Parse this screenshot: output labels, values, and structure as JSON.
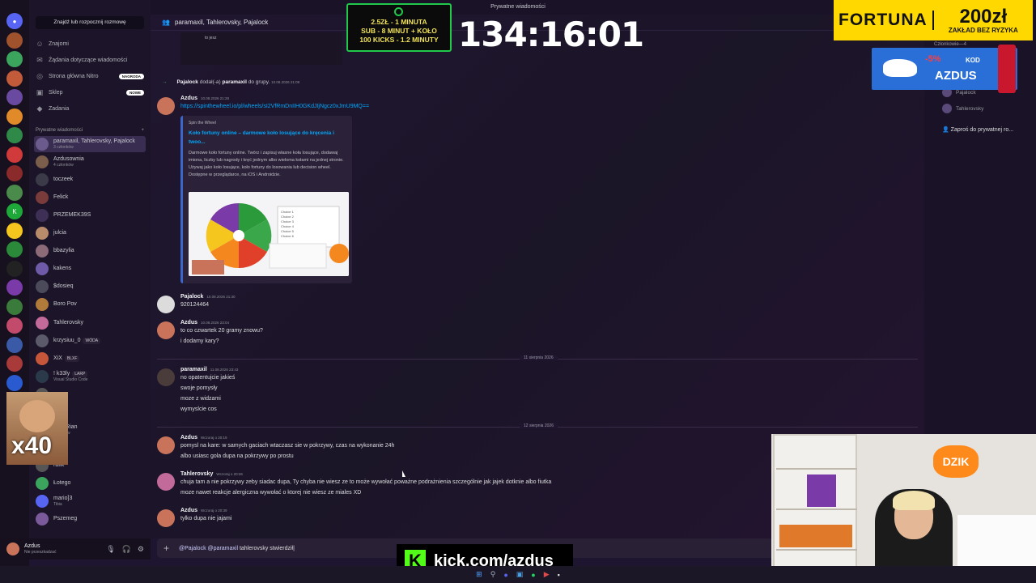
{
  "window": {
    "title": "Prywatne wiadomości"
  },
  "sidebar": {
    "search_button": "Znajdź lub rozpocznij rozmowę",
    "nav": [
      {
        "label": "Znajomi",
        "icon": "friends-icon"
      },
      {
        "label": "Żądania dotyczące wiadomości",
        "icon": "message-requests-icon"
      },
      {
        "label": "Strona główna Nitro",
        "icon": "nitro-icon",
        "badge": "NAGRODA"
      },
      {
        "label": "Sklep",
        "icon": "shop-icon",
        "badge": "NOWE"
      },
      {
        "label": "Zadania",
        "icon": "quests-icon"
      }
    ],
    "dm_header": "Prywatne wiadomości",
    "dm_add": "+",
    "dms": [
      {
        "name": "paramaxil, Tahlerovsky, Pajalock",
        "sub": "3 członków",
        "active": true,
        "color": "#6b5a8c"
      },
      {
        "name": "Azdusownia",
        "sub": "4 członków",
        "color": "#7a5d4a"
      },
      {
        "name": "toczeek",
        "sub": "",
        "color": "#3a3a48"
      },
      {
        "name": "Felick",
        "sub": "",
        "color": "#7a3b3b"
      },
      {
        "name": "PRZEMEK39S",
        "sub": "",
        "color": "#3d2f55"
      },
      {
        "name": "julcia",
        "sub": "",
        "color": "#b88b6a"
      },
      {
        "name": "bbazylia",
        "sub": "",
        "color": "#8c6a78"
      },
      {
        "name": "kakens",
        "sub": "",
        "color": "#6e5aa8"
      },
      {
        "name": "$dosieq",
        "sub": "",
        "color": "#4a4a5a"
      },
      {
        "name": "Boro Pov",
        "sub": "",
        "color": "#b07a3a"
      },
      {
        "name": "Tahlerovsky",
        "sub": "",
        "color": "#c26a9a"
      },
      {
        "name": "krzysiuu_0",
        "sub": "",
        "tag": "WÓDA",
        "color": "#5a5a6a"
      },
      {
        "name": "XiX",
        "sub": "",
        "tag": "BLXF",
        "color": "#c6563a"
      },
      {
        "name": "! k33ly",
        "sub": "Visual Studio Code",
        "tag": "LARP",
        "color": "#2b3a4a"
      },
      {
        "name": "uss",
        "sub": "",
        "color": "#555"
      },
      {
        "name": "cxEQ",
        "sub": "",
        "color": "#444"
      },
      {
        "name": "jpur, Rian",
        "sub": "członków",
        "color": "#555"
      },
      {
        "name": "chito",
        "sub": "",
        "color": "#555"
      },
      {
        "name": "rafik",
        "sub": "",
        "color": "#555"
      },
      {
        "name": "Łotego",
        "sub": "",
        "color": "#3ba55d"
      },
      {
        "name": "mario]3",
        "sub": "Tibia",
        "color": "#5865f2"
      },
      {
        "name": "Pszemeg",
        "sub": "",
        "color": "#7a5a9a"
      }
    ],
    "user": {
      "name": "Azdus",
      "status": "Nie przeszkadzać"
    },
    "webcam_label": "x40"
  },
  "chat": {
    "header": "paramaxil, Tahlerovsky, Pajalock",
    "top_snippet": "to jesz",
    "system": {
      "actor": "Pajalock",
      "action": "dodał(-a)",
      "target": "paramaxil",
      "suffix": "do grupy.",
      "time": "10.08.2026 21:09"
    },
    "messages": [
      {
        "author": "Azdus",
        "time": "10.08.2026 21:28",
        "lines": [
          "https://spinthewheel.io/pl/wheels/sI2VfRmDnIIH0GKdJIjNgcz0xJmU9MQ=="
        ],
        "link": true,
        "color": "#c9745a"
      },
      {
        "author": "Pajalock",
        "time": "10.08.2026 21:30",
        "lines": [
          "920124464"
        ],
        "color": "#dcdcdc"
      },
      {
        "author": "Azdus",
        "time": "10.08.2026 23:04",
        "lines": [
          "to co czwartek 20 gramy znowu?",
          "i dodamy kary?"
        ],
        "color": "#c9745a"
      },
      {
        "author": "paramaxil",
        "time": "11.08.2026 23:43",
        "lines": [
          "no opatentujcie jakieś",
          "swoje pomysły",
          "moze z widzami",
          "wymyslcie cos"
        ],
        "color": "#4a3c3a"
      },
      {
        "author": "Azdus",
        "time": "Wczoraj o 20:19",
        "lines": [
          "pomysl na kare: w samych gaciach wtaczasz sie w pokrzywy, czas na wykonanie 24h",
          "albo usiasc gola dupa na pokrzywy po prostu"
        ],
        "color": "#c9745a"
      },
      {
        "author": "Tahlerovsky",
        "time": "Wczoraj o 20:26",
        "lines": [
          "chuja tam a nie pokrzywy zeby siadac dupa, Ty chyba nie wiesz ze to może wywołać poważne podrażnienia szczególnie jak jajek dotknie albo fiutka",
          "moze nawet reakcje alergiczna wywołać o ktorej nie wiesz ze miales XD"
        ],
        "color": "#c26a9a"
      },
      {
        "author": "Azdus",
        "time": "Wczoraj o 20:39",
        "lines": [
          "tylko dupa nie jajami"
        ],
        "color": "#c9745a"
      }
    ],
    "dividers": [
      "11 sierpnia 2026",
      "12 sierpnia 2026"
    ],
    "embed": {
      "provider": "Spin the Wheel",
      "title": "Koło fortuny online – darmowe koło losujące do kręcenia i twoo...",
      "description": "Darmowe koło fortuny online. Twórz i zapisuj własne koła losujące, dodawaj imiona, liczby lub nagrody i kręć jednym albo wieloma kołami na jednej stronie. Używaj jako koło losujące, koło fortuny do losowania lub decision wheel. Dostępne w przeglądarce, na iOS i Androidzie.",
      "preview_items": [
        "Choice 1",
        "Choice 2",
        "Choice 3",
        "Choice 4",
        "Choice 5",
        "Choice 6"
      ]
    },
    "input": {
      "mention1": "@Pajalock",
      "mention2": "@paramaxil",
      "text": "tahlerovsky stwierdził"
    }
  },
  "members_panel": {
    "header": "Członkowie—4",
    "members": [
      "Pajalock",
      "Tahlerovsky"
    ],
    "invite": "Zaproś do prywatnej ro..."
  },
  "overlays": {
    "donation_lines": [
      "2.5ZŁ - 1 MINUTA",
      "SUB - 8 MINUT + KOŁO",
      "100 KICKS - 1.2 MINUTY"
    ],
    "timer": "134:16:01",
    "fortuna": {
      "brand": "FORTUNA",
      "amount": "200zł",
      "sub": "ZAKŁAD BEZ RYZYKA"
    },
    "dzik": {
      "discount": "-5%",
      "kod": "KOD",
      "code": "AZDUS",
      "brand": "DZIK"
    },
    "kick_url": "kick.com/azdus"
  },
  "colors": {
    "accent": "#5865f2",
    "kick_green": "#53fc18",
    "link": "#00a8fc",
    "fortuna_yellow": "#ffd800"
  }
}
